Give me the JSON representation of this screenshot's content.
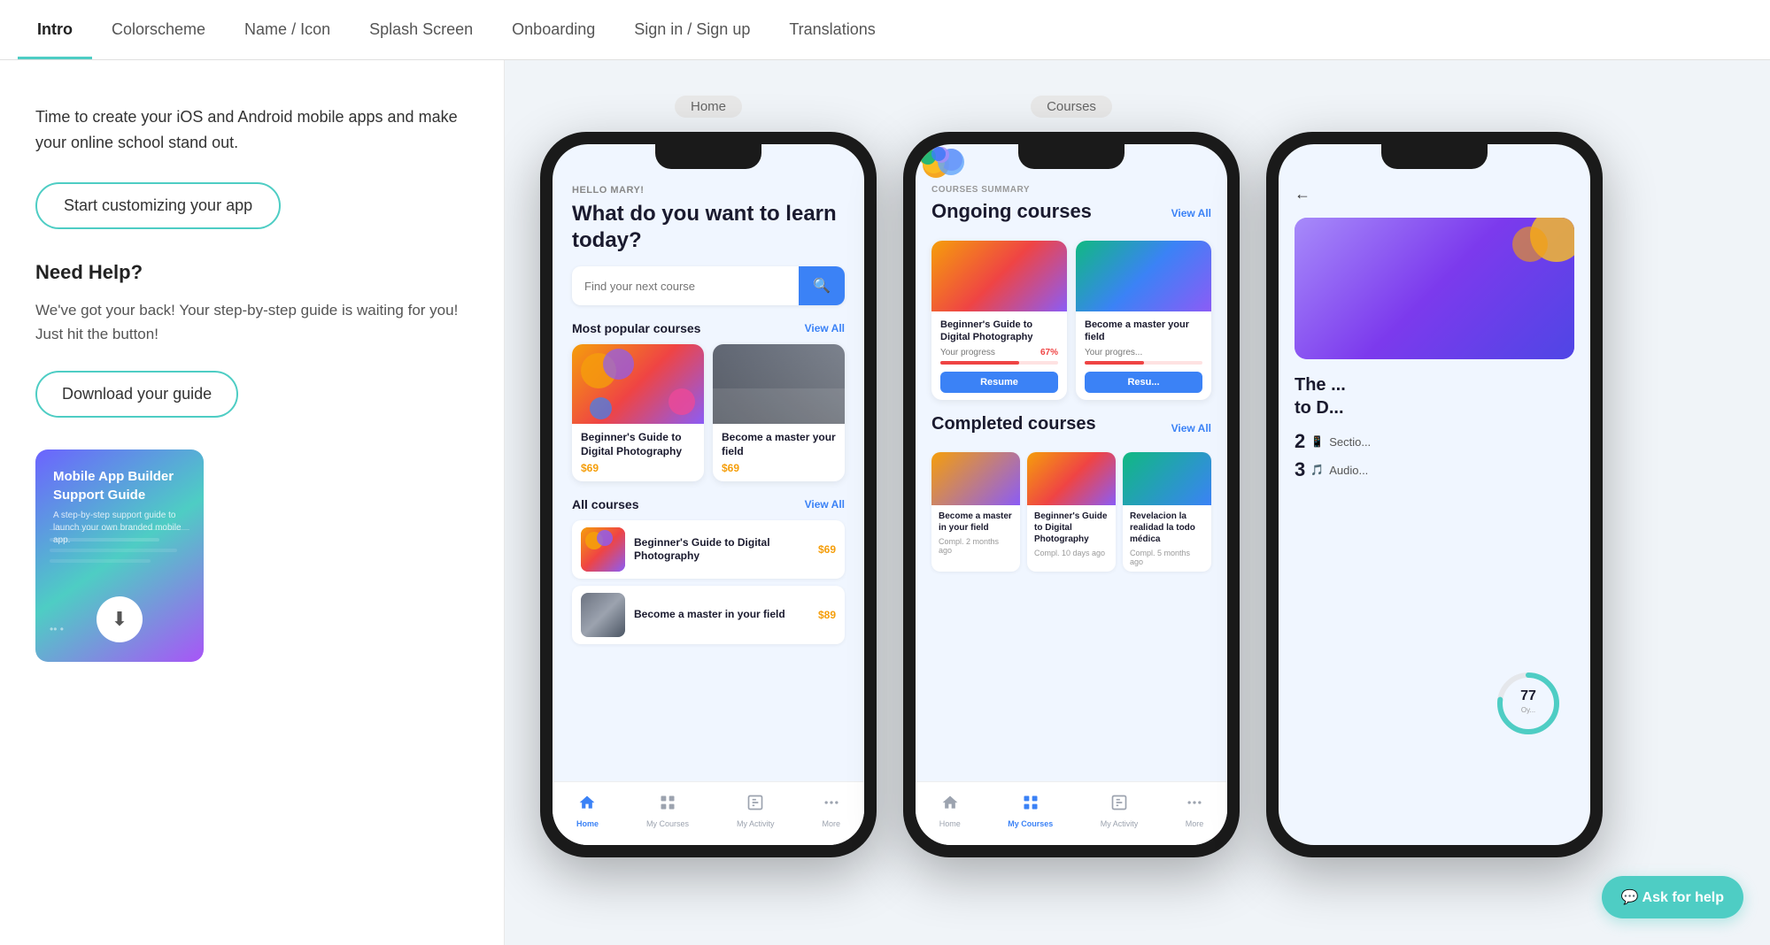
{
  "nav": {
    "tabs": [
      {
        "id": "intro",
        "label": "Intro",
        "active": true
      },
      {
        "id": "colorscheme",
        "label": "Colorscheme",
        "active": false
      },
      {
        "id": "name-icon",
        "label": "Name / Icon",
        "active": false
      },
      {
        "id": "splash-screen",
        "label": "Splash Screen",
        "active": false
      },
      {
        "id": "onboarding",
        "label": "Onboarding",
        "active": false
      },
      {
        "id": "sign-in",
        "label": "Sign in / Sign up",
        "active": false
      },
      {
        "id": "translations",
        "label": "Translations",
        "active": false
      }
    ]
  },
  "left": {
    "intro_text": "Time to create your iOS and Android mobile apps and make your online school stand out.",
    "cta_button": "Start customizing your app",
    "need_help_title": "Need Help?",
    "need_help_text": "We've got your back! Your step-by-step guide is waiting for you! Just hit the button!",
    "download_button": "Download your guide",
    "guide_card": {
      "title": "Mobile App Builder Support Guide",
      "subtitle": "A step-by-step support guide to launch your own branded mobile app.",
      "download_label": "⬇"
    }
  },
  "phone_home": {
    "label": "Home",
    "greeting": "HELLO MARY!",
    "headline": "What do you want to learn today?",
    "search_placeholder": "Find your next course",
    "popular_title": "Most popular courses",
    "view_all": "View All",
    "courses": [
      {
        "name": "Beginner's Guide to Digital Photography",
        "price": "$69"
      },
      {
        "name": "Become a master your field",
        "price": "$69"
      }
    ],
    "all_courses_title": "All courses",
    "all_courses_view_all": "View All",
    "all_courses": [
      {
        "name": "Beginner's Guide to Digital Photography",
        "price": "$69"
      },
      {
        "name": "Become a master in your field",
        "price": "$89"
      }
    ],
    "bottom_nav": [
      {
        "icon": "🏠",
        "label": "Home",
        "active": true
      },
      {
        "icon": "📚",
        "label": "My Courses",
        "active": false
      },
      {
        "icon": "📊",
        "label": "My Activity",
        "active": false
      },
      {
        "icon": "•••",
        "label": "More",
        "active": false
      }
    ]
  },
  "phone_courses": {
    "label": "Courses",
    "summary_label": "COURSES SUMMARY",
    "ongoing_title": "Ongoing courses",
    "view_all": "View All",
    "ongoing_courses": [
      {
        "name": "Beginner's Guide to Digital Photography",
        "progress_label": "Your progress",
        "progress": 67,
        "progress_pct": "67%",
        "btn": "Resume"
      },
      {
        "name": "Become a master your field",
        "progress_label": "Your progres...",
        "progress": 50,
        "progress_pct": "",
        "btn": "Resu..."
      }
    ],
    "completed_title": "Completed courses",
    "completed_view_all": "View All",
    "completed_courses": [
      {
        "name": "Become a master in your field",
        "date": "Compl. 2 months ago"
      },
      {
        "name": "Beginner's Guide to Digital Photography",
        "date": "Compl. 10 days ago"
      },
      {
        "name": "Revelacion la realidad la todo médica",
        "date": "Compl. 5 months ago"
      }
    ],
    "bottom_nav": [
      {
        "icon": "🏠",
        "label": "Home",
        "active": false
      },
      {
        "icon": "📚",
        "label": "My Courses",
        "active": true
      },
      {
        "icon": "📊",
        "label": "My Activity",
        "active": false
      },
      {
        "icon": "•••",
        "label": "More",
        "active": false
      }
    ]
  },
  "phone_third": {
    "course_title": "The ... to D...",
    "stat1_num": "2",
    "stat1_label": "Sectio...",
    "stat2_num": "3",
    "stat2_label": "Audio...",
    "progress_num": "77",
    "progress_label": "Oy... Pro..."
  },
  "ask_help_btn": "💬 Ask for help"
}
